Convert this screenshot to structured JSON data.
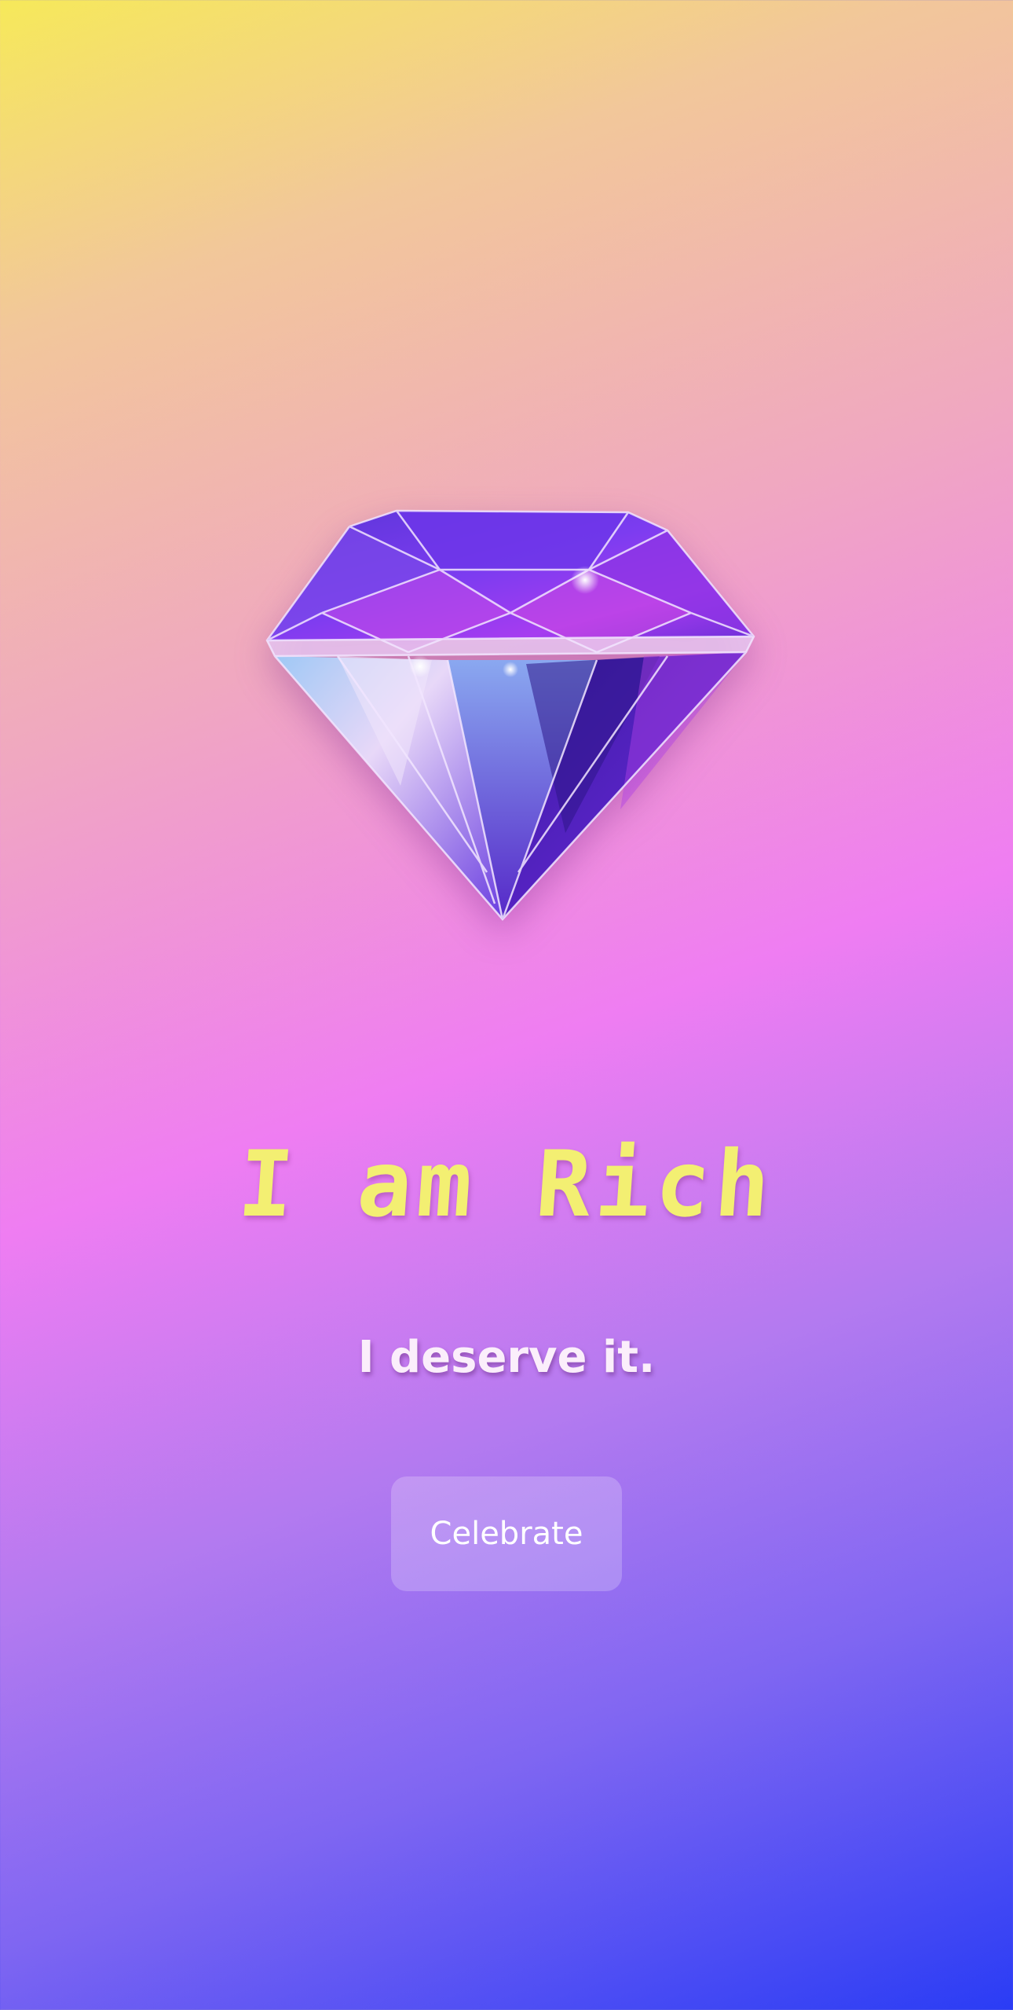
{
  "hero": {
    "icon": "diamond-icon",
    "headline": "I am Rich",
    "subline": "I deserve it."
  },
  "actions": {
    "celebrate_label": "Celebrate"
  },
  "colors": {
    "headline": "#f3ef72",
    "subline": "#fbeefb",
    "gradient_start": "#f6e95a",
    "gradient_mid": "#ef7df2",
    "gradient_end": "#2a3cf5",
    "diamond_primary": "#6a2fe0"
  }
}
